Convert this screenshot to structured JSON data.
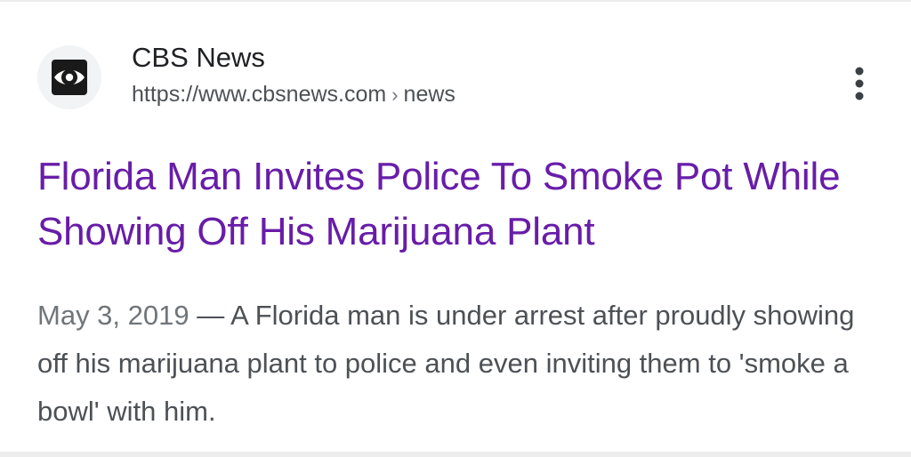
{
  "result": {
    "site_name": "CBS News",
    "url": "https://www.cbsnews.com",
    "url_separator": "›",
    "url_path": "news",
    "favicon_icon": "cbs-eye-logo-icon",
    "more_icon": "more-vert-icon",
    "title": "Florida Man Invites Police To Smoke Pot While Showing Off His Marijuana Plant",
    "date": "May 3, 2019",
    "dash": " — ",
    "snippet": "A Florida man is under arrest after proudly showing off his marijuana plant to police and even inviting them to 'smoke a bowl' with him."
  },
  "colors": {
    "title_visited": "#681da8",
    "site_name": "#202124",
    "url": "#4d5156",
    "snippet": "#4d5156",
    "favicon_bg": "#f1f3f4"
  }
}
